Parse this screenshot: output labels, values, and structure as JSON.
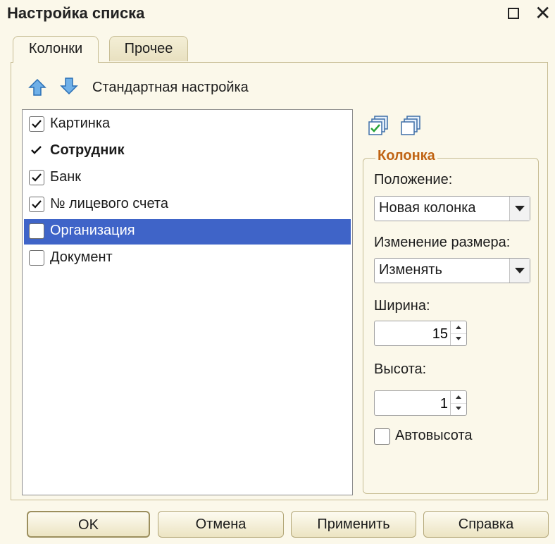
{
  "window": {
    "title": "Настройка списка"
  },
  "tabs": [
    {
      "label": "Колонки",
      "active": true
    },
    {
      "label": "Прочее",
      "active": false
    }
  ],
  "toolbar": {
    "move_up_icon": "arrow-up-icon",
    "move_down_icon": "arrow-down-icon",
    "standard_settings_label": "Стандартная настройка",
    "check_all_icon": "check-all-icon",
    "uncheck_all_icon": "uncheck-all-icon"
  },
  "columns_list": {
    "items": [
      {
        "label": "Картинка",
        "checked": true,
        "bold": false,
        "selected": false,
        "checkbox": true
      },
      {
        "label": "Сотрудник",
        "checked": true,
        "bold": true,
        "selected": false,
        "checkbox": false
      },
      {
        "label": "Банк",
        "checked": true,
        "bold": false,
        "selected": false,
        "checkbox": true
      },
      {
        "label": "№ лицевого счета",
        "checked": true,
        "bold": false,
        "selected": false,
        "checkbox": true
      },
      {
        "label": "Организация",
        "checked": false,
        "bold": false,
        "selected": true,
        "checkbox": true
      },
      {
        "label": "Документ",
        "checked": false,
        "bold": false,
        "selected": false,
        "checkbox": true
      }
    ]
  },
  "column_group": {
    "title": "Колонка",
    "position_label": "Положение:",
    "position_value": "Новая колонка",
    "resize_label": "Изменение размера:",
    "resize_value": "Изменять",
    "width_label": "Ширина:",
    "width_value": "15",
    "height_label": "Высота:",
    "height_value": "1",
    "autoheight_label": "Автовысота",
    "autoheight_checked": false
  },
  "buttons": {
    "ok": "OK",
    "cancel": "Отмена",
    "apply": "Применить",
    "help": "Справка"
  },
  "colors": {
    "background": "#fbf8ea",
    "selection": "#3f64c8",
    "group_title": "#c06414",
    "border": "#c7bd94"
  }
}
